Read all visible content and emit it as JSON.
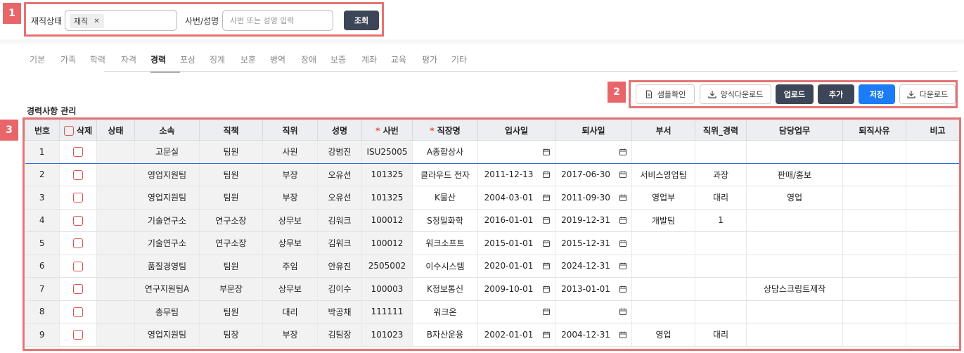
{
  "callouts": {
    "one": "1",
    "two": "2",
    "three": "3"
  },
  "search": {
    "status_label": "재직상태",
    "status_tag": "재직",
    "status_tag_remove": "✕",
    "id_name_label": "사번/성명",
    "id_name_placeholder": "사번 또는 성명 입력",
    "search_button": "조회"
  },
  "tabs": [
    "기본",
    "가족",
    "학력",
    "자격",
    "경력",
    "포상",
    "징계",
    "보훈",
    "병역",
    "장애",
    "보증",
    "계좌",
    "교육",
    "평가",
    "기타"
  ],
  "active_tab": "경력",
  "toolbar": {
    "sample": "샘플확인",
    "template_download": "양식다운로드",
    "upload": "업로드",
    "add": "추가",
    "save": "저장",
    "download": "다운로드"
  },
  "section_title": "경력사항 관리",
  "table": {
    "headers": {
      "no": "번호",
      "delete": "삭제",
      "status": "상태",
      "dept": "소속",
      "role": "직책",
      "rank": "직위",
      "name": "성명",
      "emp_no": "사번",
      "company": "직장명",
      "join": "입사일",
      "leave": "퇴사일",
      "division": "부서",
      "rank_career": "직위_경력",
      "duty": "담당업무",
      "reason": "퇴직사유",
      "note": "비고"
    },
    "required_mark": "*",
    "rows": [
      {
        "no": "1",
        "dept": "고문실",
        "role": "팀원",
        "rank": "사원",
        "name": "강범진",
        "emp_no": "ISU25005",
        "company": "A종합상사",
        "join": "",
        "leave": "",
        "division": "",
        "rank_career": "",
        "duty": ""
      },
      {
        "no": "2",
        "dept": "영업지원팀",
        "role": "팀원",
        "rank": "부장",
        "name": "오유선",
        "emp_no": "101325",
        "company": "클라우드 전자",
        "join": "2011-12-13",
        "leave": "2017-06-30",
        "division": "서비스영업팀",
        "rank_career": "과장",
        "duty": "판매/홍보"
      },
      {
        "no": "3",
        "dept": "영업지원팀",
        "role": "팀원",
        "rank": "부장",
        "name": "오유선",
        "emp_no": "101325",
        "company": "K물산",
        "join": "2004-03-01",
        "leave": "2011-09-30",
        "division": "영업부",
        "rank_career": "대리",
        "duty": "영업"
      },
      {
        "no": "4",
        "dept": "기술연구소",
        "role": "연구소장",
        "rank": "상무보",
        "name": "김워크",
        "emp_no": "100012",
        "company": "S정밀화학",
        "join": "2016-01-01",
        "leave": "2019-12-31",
        "division": "개발팀",
        "rank_career": "1",
        "duty": ""
      },
      {
        "no": "5",
        "dept": "기술연구소",
        "role": "연구소장",
        "rank": "상무보",
        "name": "김워크",
        "emp_no": "100012",
        "company": "워크소프트",
        "join": "2015-01-01",
        "leave": "2015-12-31",
        "division": "",
        "rank_career": "",
        "duty": ""
      },
      {
        "no": "6",
        "dept": "품질경영팀",
        "role": "팀원",
        "rank": "주임",
        "name": "안유진",
        "emp_no": "2505002",
        "company": "이수시스템",
        "join": "2020-01-01",
        "leave": "2024-12-31",
        "division": "",
        "rank_career": "",
        "duty": ""
      },
      {
        "no": "7",
        "dept": "연구지원팀A",
        "role": "부문장",
        "rank": "상무보",
        "name": "김이수",
        "emp_no": "100003",
        "company": "K정보통신",
        "join": "2009-10-01",
        "leave": "2013-01-01",
        "division": "",
        "rank_career": "",
        "duty": "상담스크립트제작"
      },
      {
        "no": "8",
        "dept": "총무팀",
        "role": "팀원",
        "rank": "대리",
        "name": "박공채",
        "emp_no": "111111",
        "company": "워크온",
        "join": "",
        "leave": "",
        "division": "",
        "rank_career": "",
        "duty": ""
      },
      {
        "no": "9",
        "dept": "영업지원팀",
        "role": "팀장",
        "rank": "부장",
        "name": "김팀장",
        "emp_no": "101023",
        "company": "B자산운용",
        "join": "2002-01-01",
        "leave": "2004-12-31",
        "division": "영업",
        "rank_career": "대리",
        "duty": ""
      }
    ]
  }
}
